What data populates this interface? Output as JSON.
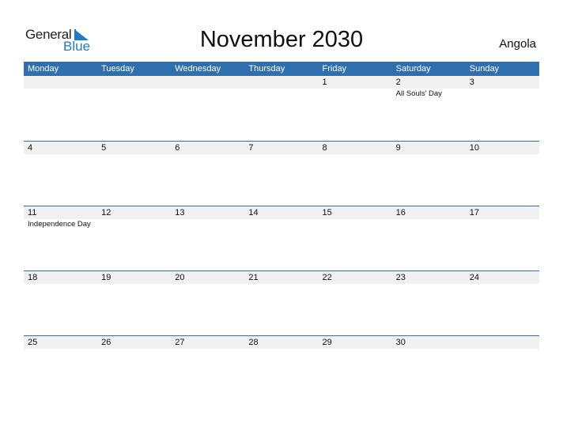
{
  "logo": {
    "line1": "General",
    "line2": "Blue"
  },
  "title": "November 2030",
  "country": "Angola",
  "colors": {
    "header": "#2f6fae",
    "accent": "#1f7ac8",
    "date_strip": "#f1f1f1"
  },
  "weekdays": [
    "Monday",
    "Tuesday",
    "Wednesday",
    "Thursday",
    "Friday",
    "Saturday",
    "Sunday"
  ],
  "weeks": [
    [
      {
        "d": ""
      },
      {
        "d": ""
      },
      {
        "d": ""
      },
      {
        "d": ""
      },
      {
        "d": "1"
      },
      {
        "d": "2",
        "e": "All Souls' Day"
      },
      {
        "d": "3"
      }
    ],
    [
      {
        "d": "4"
      },
      {
        "d": "5"
      },
      {
        "d": "6"
      },
      {
        "d": "7"
      },
      {
        "d": "8"
      },
      {
        "d": "9"
      },
      {
        "d": "10"
      }
    ],
    [
      {
        "d": "11",
        "e": "Independence Day"
      },
      {
        "d": "12"
      },
      {
        "d": "13"
      },
      {
        "d": "14"
      },
      {
        "d": "15"
      },
      {
        "d": "16"
      },
      {
        "d": "17"
      }
    ],
    [
      {
        "d": "18"
      },
      {
        "d": "19"
      },
      {
        "d": "20"
      },
      {
        "d": "21"
      },
      {
        "d": "22"
      },
      {
        "d": "23"
      },
      {
        "d": "24"
      }
    ],
    [
      {
        "d": "25"
      },
      {
        "d": "26"
      },
      {
        "d": "27"
      },
      {
        "d": "28"
      },
      {
        "d": "29"
      },
      {
        "d": "30"
      },
      {
        "d": ""
      }
    ]
  ]
}
